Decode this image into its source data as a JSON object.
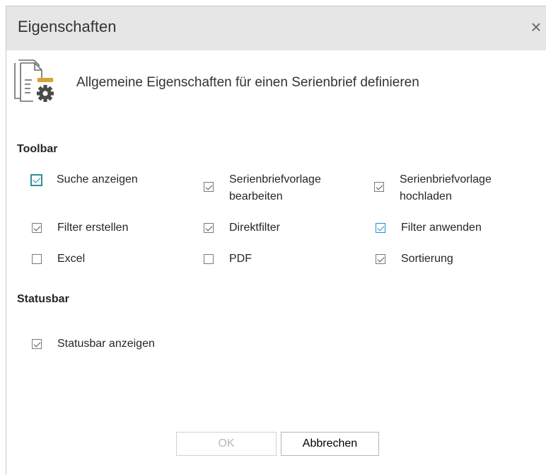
{
  "dialog": {
    "title": "Eigenschaften",
    "close_glyph": "×",
    "header_text": "Allgemeine Eigenschaften für einen Serienbrief definieren",
    "header_icon": "document-settings-icon"
  },
  "toolbar_section": {
    "title": "Toolbar",
    "options": [
      {
        "label": "Suche anzeigen",
        "checked": true
      },
      {
        "label": "Serienbriefvorlage bearbeiten",
        "checked": true
      },
      {
        "label": "Serienbriefvorlage hochladen",
        "checked": true
      },
      {
        "label": "Filter erstellen",
        "checked": true
      },
      {
        "label": "Direktfilter",
        "checked": true
      },
      {
        "label": "Filter anwenden",
        "checked": true
      },
      {
        "label": "Excel",
        "checked": false
      },
      {
        "label": "PDF",
        "checked": false
      },
      {
        "label": "Sortierung",
        "checked": true
      }
    ]
  },
  "statusbar_section": {
    "title": "Statusbar",
    "options": [
      {
        "label": "Statusbar anzeigen",
        "checked": true
      }
    ]
  },
  "buttons": {
    "ok": "OK",
    "cancel": "Abbrechen"
  },
  "colors": {
    "titlebar_bg": "#e6e6e6",
    "focus_accent": "#2e8f99",
    "hover_accent": "#1e90d4"
  }
}
